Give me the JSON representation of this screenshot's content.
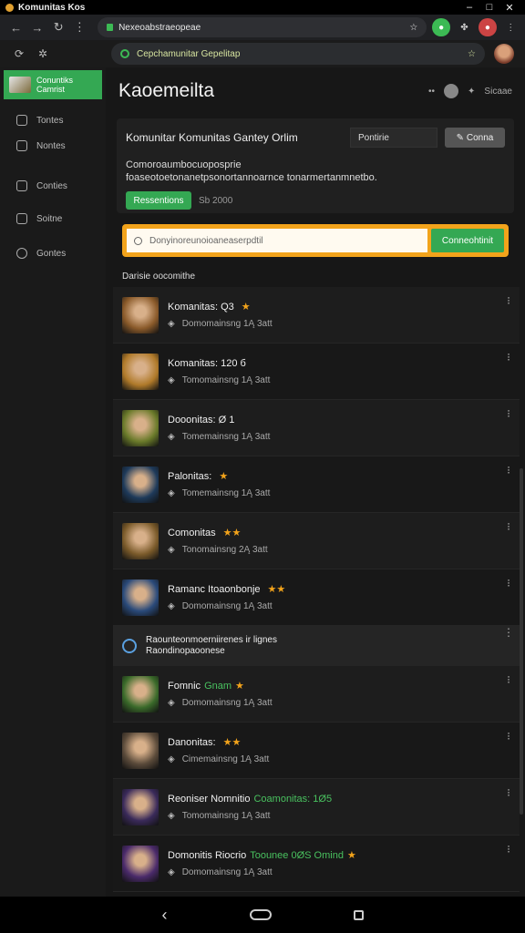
{
  "window": {
    "title": "Komunitas Kos"
  },
  "browser": {
    "url": "Nexeoabstraeopeae",
    "search_text": "Cepchamunitar Gepelitap"
  },
  "sidebar": {
    "brand_line1": "Conuntiks",
    "brand_line2": "Camrist",
    "items": [
      {
        "label": "Tontes",
        "icon": "home-icon"
      },
      {
        "label": "Nontes",
        "icon": "folder-icon"
      },
      {
        "label": "Conties",
        "icon": "group-icon"
      },
      {
        "label": "Soitne",
        "icon": "page-icon"
      },
      {
        "label": "Gontes",
        "icon": "circle-icon"
      }
    ]
  },
  "header": {
    "title": "Kaoemeilta",
    "mini": "••",
    "right_label": "Sicaae"
  },
  "card": {
    "title": "Komunitar Komunitas Ganteу Orlim",
    "input_value": "Pontirie",
    "button_label": "Conna",
    "description": "Comoroaumbocuoposprie foaseotoetonanetpsonortannoarnce tonarmertanmnetbo.",
    "green_button": "Ressentions",
    "sub": "Sb 2000"
  },
  "search": {
    "placeholder": "Donyinoreunoioaneaserpdtil",
    "button": "Conneohtinit"
  },
  "section_title": "Darisie oocomithe",
  "rows": [
    {
      "name": "Komanitas: Q3",
      "extra": "",
      "meta": "Domomainsng 1Ą 3att",
      "stars": "★",
      "color": "#8a5a2a"
    },
    {
      "name": "Komanitas: 120 б",
      "extra": "",
      "meta": "Tomomainsng 1Ą 3att",
      "stars": "",
      "color": "#b07a2a"
    },
    {
      "name": "Dooonitas: Ø 1",
      "extra": "",
      "meta": "Tomemainsng 1Ą 3att",
      "stars": "",
      "color": "#6a7a2a"
    },
    {
      "name": "Palonitas:",
      "extra": "",
      "meta": "Tomemainsng 1Ą 3att",
      "stars": "★",
      "color": "#1e3a5a"
    },
    {
      "name": "Comonitas",
      "extra": "",
      "meta": "Tonomainsng 2Ą 3att",
      "stars": "★★",
      "color": "#7a5a2a"
    },
    {
      "name": "Ramanc Itoaonbonje",
      "extra": "",
      "meta": "Domomainsng 1Ą 3att",
      "stars": "★★",
      "color": "#2a4a7a"
    }
  ],
  "notice": {
    "line1": "Raounteonmoerniirenes ir lignes",
    "line2": "Raondinopaoonese"
  },
  "rows2": [
    {
      "name": "Fomnic",
      "extra": "Gnam",
      "meta": "Domomainsng 1Ą 3att",
      "stars": "★",
      "color": "#3a6a2a"
    },
    {
      "name": "Danonitas:",
      "extra": "",
      "meta": "Cimemainsng 1Ą 3att",
      "stars": "★★",
      "color": "#5a4a3a"
    },
    {
      "name": "Reoniser Nomnitio",
      "extra": "Coamonitas: 1Ø5",
      "meta": "Tomomainsng 1Ą 3att",
      "stars": "",
      "color": "#3a2a5a"
    },
    {
      "name": "Domonitis Riocrio",
      "extra": "Toounee 0ØS Omind",
      "meta": "Domomainsng 1Ą 3att",
      "stars": "★",
      "color": "#4a2a6a"
    }
  ]
}
